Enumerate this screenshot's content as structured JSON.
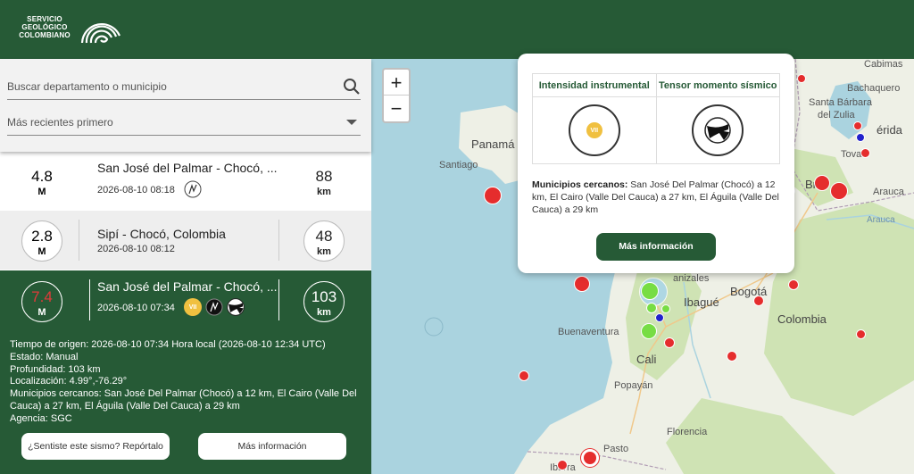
{
  "header": {
    "logo_line1": "SERVICIO",
    "logo_line2": "GEOLÓGICO",
    "logo_line3": "COLOMBIANO",
    "logo_icon": "spiral-rainbow-logo"
  },
  "search": {
    "placeholder": "Buscar departamento o municipio",
    "search_icon": "search-icon",
    "sort_value": "Más recientes primero",
    "sort_icon": "chevron-down-icon"
  },
  "events": [
    {
      "mag": "4.8",
      "mag_unit": "M",
      "title": "San José del Palmar - Chocó, ...",
      "time": "2026-08-10 08:18",
      "dist": "88",
      "dist_unit": "km"
    },
    {
      "mag": "2.8",
      "mag_unit": "M",
      "title": "Sipí - Chocó, Colombia",
      "time": "2026-08-10 08:12",
      "dist": "48",
      "dist_unit": "km"
    },
    {
      "mag": "7.4",
      "mag_unit": "M",
      "title": "San José del Palmar - Chocó, ...",
      "time": "2026-08-10 07:34",
      "dist": "103",
      "dist_unit": "km",
      "intensity": "VII"
    }
  ],
  "details": {
    "origin": "Tiempo de origen: 2026-08-10 07:34 Hora local (2026-08-10 12:34 UTC)",
    "status": "Estado: Manual",
    "depth": "Profundidad: 103 km",
    "location": "Localización: 4.99°,-76.29°",
    "municipalities": "Municipios cercanos: San José Del Palmar (Chocó) a 12 km, El Cairo (Valle Del Cauca) a 27 km, El Águila (Valle Del Cauca) a 29 km",
    "agency": "Agencia: SGC",
    "felt_button": "¿Sentiste este sismo? Repórtalo",
    "more_button": "Más información"
  },
  "popup": {
    "col1_header": "Intensidad instrumental",
    "col2_header": "Tensor momento sísmico",
    "intensity": "VII",
    "muni_label": "Municipios cercanos:",
    "muni_text": "San José Del Palmar (Chocó) a 12 km, El Cairo (Valle Del Cauca) a 27 km, El Águila (Valle Del Cauca) a 29 km",
    "button": "Más información"
  },
  "map": {
    "zoom_in": "+",
    "zoom_out": "−",
    "labels": {
      "panama": "Panamá",
      "santiago": "Santiago",
      "cabimas": "Cabimas",
      "bachaquero": "Bachaquero",
      "santa_barbara": "Santa Bárbara",
      "del_zulia": "del Zulia",
      "merida": "érida",
      "tovar": "Tovar",
      "br": "Br",
      "arauca": "Arauca",
      "arauca_river": "Arauca",
      "manizales": "anizales",
      "bogota": "Bogotá",
      "ibague": "Ibagué",
      "colombia": "Colombia",
      "buenaventura": "Buenaventura",
      "cali": "Cali",
      "popayan": "Popayán",
      "florencia": "Florencia",
      "pasto": "Pasto",
      "ibarra": "Ibarra"
    },
    "colors": {
      "land": "#eef0e6",
      "sea": "#aad3df",
      "green": "#cfe3b4",
      "red": "#e52d2d",
      "blue": "#2222cc",
      "lightgreen": "#77dd44"
    }
  }
}
